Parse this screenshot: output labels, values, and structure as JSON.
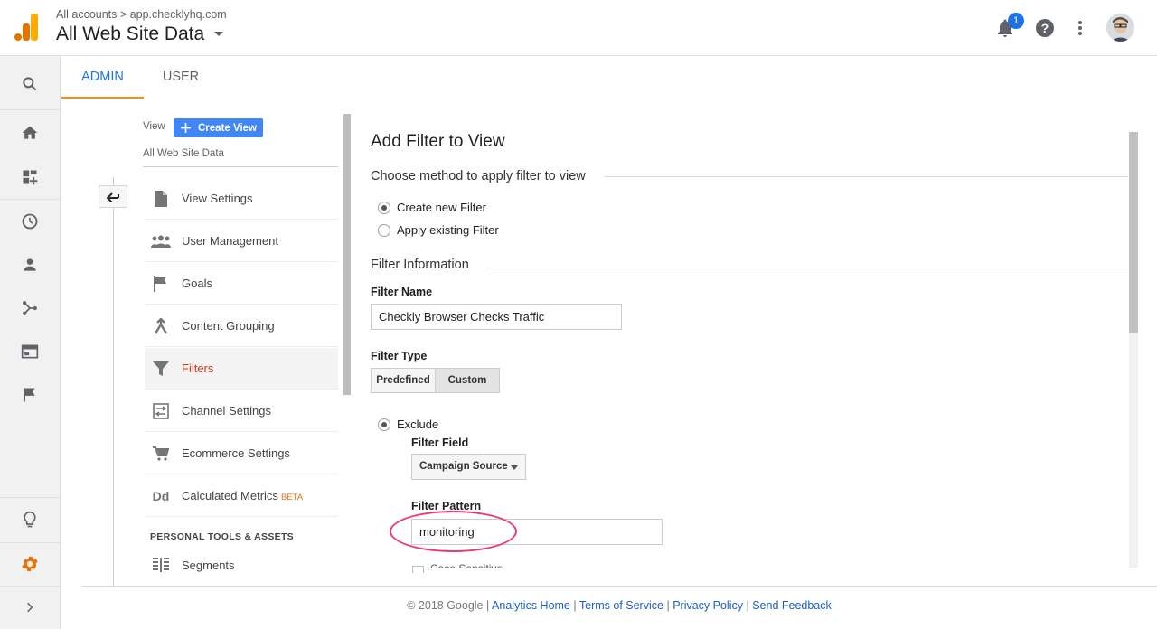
{
  "header": {
    "breadcrumb_root": "All accounts",
    "breadcrumb_sep": ">",
    "breadcrumb_account": "app.checklyhq.com",
    "property_title": "All Web Site Data",
    "notification_count": "1",
    "icons": [
      "analytics-logo-icon",
      "notifications-bell-icon",
      "help-icon",
      "more-vert-icon",
      "avatar"
    ]
  },
  "rail": {
    "items": [
      "search-icon",
      "home-icon",
      "customization-icon",
      "realtime-clock-icon",
      "audience-person-icon",
      "acquisition-icon",
      "behavior-icon",
      "conversions-flag-icon",
      "discover-bulb-icon",
      "admin-gear-icon",
      "expand-chevron-icon"
    ],
    "active_color": "#e8710a"
  },
  "tabs": {
    "admin": "ADMIN",
    "user": "USER"
  },
  "view_panel": {
    "view_label": "View",
    "create_view": "Create View",
    "view_name": "All Web Site Data",
    "items": [
      {
        "label": "View Settings",
        "icon": "document-icon"
      },
      {
        "label": "User Management",
        "icon": "group-icon"
      },
      {
        "label": "Goals",
        "icon": "flag-icon"
      },
      {
        "label": "Content Grouping",
        "icon": "content-grouping-icon"
      },
      {
        "label": "Filters",
        "icon": "filter-funnel-icon"
      },
      {
        "label": "Channel Settings",
        "icon": "channel-settings-icon"
      },
      {
        "label": "Ecommerce Settings",
        "icon": "cart-icon"
      },
      {
        "label": "Calculated Metrics",
        "icon": "calculated-metrics-icon",
        "badge": "BETA"
      }
    ],
    "personal_section": "PERSONAL TOOLS & ASSETS",
    "segments": "Segments",
    "active_item": "Filters",
    "active_color": "#c23b22"
  },
  "form": {
    "title": "Add Filter to View",
    "method_heading": "Choose method to apply filter to view",
    "method_options": [
      "Create new Filter",
      "Apply existing Filter"
    ],
    "method_selected": "Create new Filter",
    "info_heading": "Filter Information",
    "filter_name_label": "Filter Name",
    "filter_name_value": "Checkly Browser Checks Traffic",
    "filter_type_label": "Filter Type",
    "filter_type_options": [
      "Predefined",
      "Custom"
    ],
    "filter_type_selected": "Custom",
    "exclude_label": "Exclude",
    "filter_field_label": "Filter Field",
    "filter_field_value": "Campaign Source",
    "filter_pattern_label": "Filter Pattern",
    "filter_pattern_value": "monitoring",
    "case_sensitive_label": "Case Sensitive",
    "highlight_color": "#e8397a"
  },
  "footer": {
    "copyright": "© 2018 Google",
    "sep": "|",
    "links": [
      "Analytics Home",
      "Terms of Service",
      "Privacy Policy",
      "Send Feedback"
    ]
  }
}
